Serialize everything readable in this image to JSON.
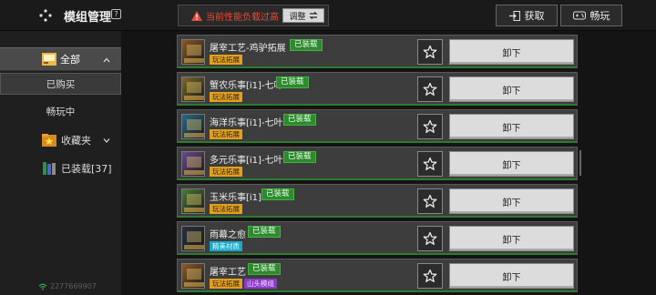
{
  "header": {
    "title": "模组管理",
    "help_icon": "question-icon",
    "warning_text": "当前性能负载过高",
    "adjust_label": "调整",
    "obtain_label": "获取",
    "play_label": "畅玩"
  },
  "sidebar": {
    "all_label": "全部",
    "bought_label": "已购买",
    "playing_label": "畅玩中",
    "favorites_label": "收藏夹",
    "installed_label": "已装载[37]",
    "user_id": "2277669907"
  },
  "mods": [
    {
      "name": "屠宰工艺-鸡驴拓展",
      "status": "已装载",
      "tags": [
        {
          "text": "玩法拓展",
          "color": "orange"
        }
      ],
      "unload": "卸下",
      "thumb_color": "#8a5a2a"
    },
    {
      "name": "蟹农乐事[i1]-七叶",
      "status": "已装载",
      "tags": [
        {
          "text": "玩法拓展",
          "color": "orange"
        }
      ],
      "unload": "卸下",
      "thumb_color": "#7a6a2a"
    },
    {
      "name": "海洋乐事[i1]-七叶",
      "status": "已装载",
      "tags": [
        {
          "text": "玩法拓展",
          "color": "orange"
        }
      ],
      "unload": "卸下",
      "thumb_color": "#2a6a8a"
    },
    {
      "name": "多元乐事[i1]-七叶",
      "status": "已装载",
      "tags": [
        {
          "text": "玩法拓展",
          "color": "orange"
        }
      ],
      "unload": "卸下",
      "thumb_color": "#6a4a8a"
    },
    {
      "name": "玉米乐事[i1]",
      "status": "已装载",
      "tags": [
        {
          "text": "玩法拓展",
          "color": "orange"
        }
      ],
      "unload": "卸下",
      "thumb_color": "#4a7a3a"
    },
    {
      "name": "雨幕之愈",
      "status": "已装载",
      "tags": [
        {
          "text": "精美材质",
          "color": "cyan"
        }
      ],
      "unload": "卸下",
      "thumb_color": "#2a3040"
    },
    {
      "name": "屠宰工艺",
      "status": "已装载",
      "tags": [
        {
          "text": "玩法拓展",
          "color": "orange"
        },
        {
          "text": "山头模组",
          "color": "purple"
        }
      ],
      "unload": "卸下",
      "thumb_color": "#8a5a2a"
    }
  ]
}
